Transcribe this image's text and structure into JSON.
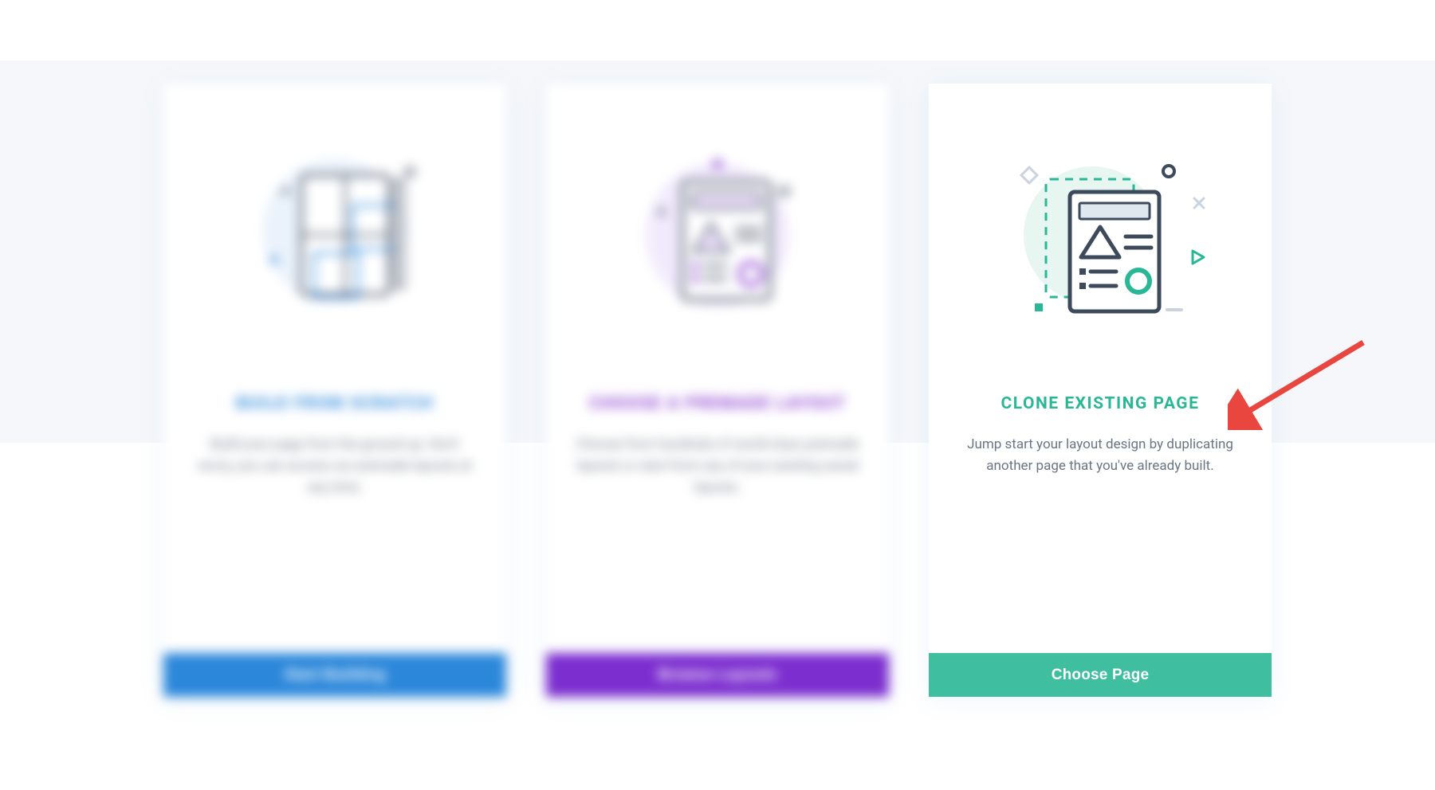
{
  "cards": [
    {
      "title": "BUILD FROM SCRATCH",
      "desc": "Build your page from the ground up. Don't worry, you can access our premade layouts at any time.",
      "button": "Start Building"
    },
    {
      "title": "CHOOSE A PREMADE LAYOUT",
      "desc": "Choose from hundreds of world-class premade layouts or start from any of your existing saved layouts.",
      "button": "Browse Layouts"
    },
    {
      "title": "CLONE EXISTING PAGE",
      "desc": "Jump start your layout design by duplicating another page that you've already built.",
      "button": "Choose Page"
    }
  ],
  "colors": {
    "blue": "#2b87da",
    "purple": "#7c2ecf",
    "teal": "#3fbfa0",
    "arrow": "#e8463f"
  }
}
